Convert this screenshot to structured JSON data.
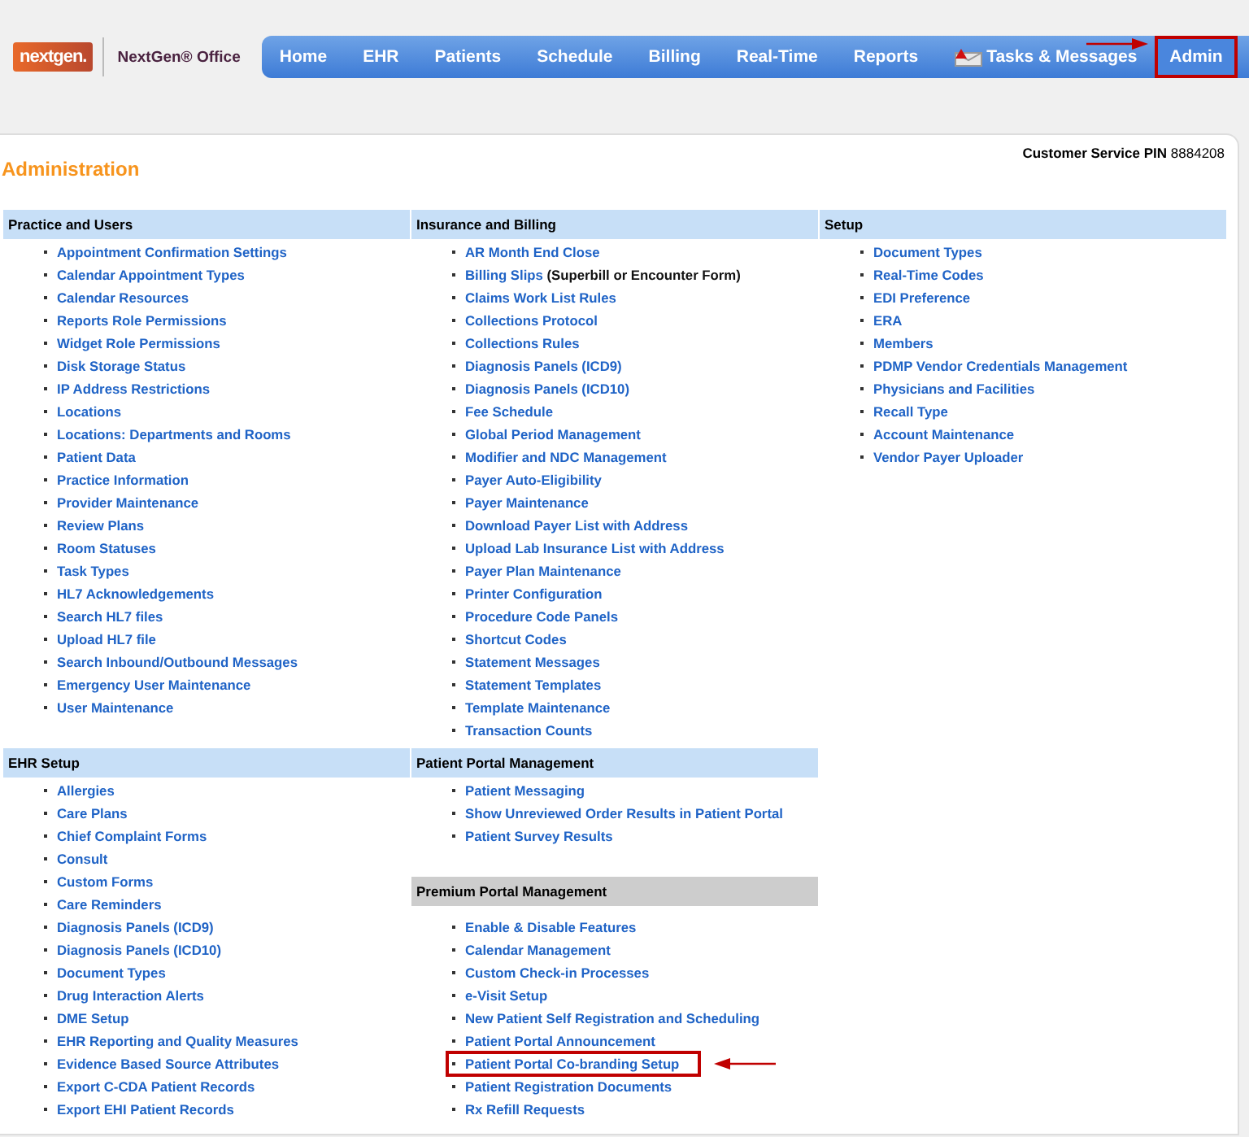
{
  "header": {
    "logo": "nextgen.",
    "product": "NextGen® Office",
    "nav": [
      {
        "label": "Home",
        "kind": "plain",
        "selected": false,
        "highlighted": false
      },
      {
        "label": "EHR",
        "kind": "plain",
        "selected": false,
        "highlighted": false
      },
      {
        "label": "Patients",
        "kind": "plain",
        "selected": false,
        "highlighted": false
      },
      {
        "label": "Schedule",
        "kind": "plain",
        "selected": false,
        "highlighted": false
      },
      {
        "label": "Billing",
        "kind": "plain",
        "selected": false,
        "highlighted": false
      },
      {
        "label": "Real-Time",
        "kind": "plain",
        "selected": false,
        "highlighted": false
      },
      {
        "label": "Reports",
        "kind": "plain",
        "selected": false,
        "highlighted": false
      },
      {
        "label": "Tasks & Messages",
        "kind": "mail",
        "selected": false,
        "highlighted": false
      },
      {
        "label": "Admin",
        "kind": "plain",
        "selected": true,
        "highlighted": true
      }
    ]
  },
  "page": {
    "title": "Administration",
    "pin_label": "Customer Service PIN",
    "pin": "8884208"
  },
  "rows": [
    {
      "columns": [
        {
          "sections": [
            {
              "title": "Practice and Users",
              "kind": "standard",
              "items": [
                {
                  "label": "Appointment Confirmation Settings",
                  "highlighted": false
                },
                {
                  "label": "Calendar Appointment Types",
                  "highlighted": false
                },
                {
                  "label": "Calendar Resources",
                  "highlighted": false
                },
                {
                  "label": "Reports Role Permissions",
                  "highlighted": false
                },
                {
                  "label": "Widget Role Permissions",
                  "highlighted": false
                },
                {
                  "label": "Disk Storage Status",
                  "highlighted": false
                },
                {
                  "label": "IP Address Restrictions",
                  "highlighted": false
                },
                {
                  "label": "Locations",
                  "highlighted": false
                },
                {
                  "label": "Locations: Departments and Rooms",
                  "highlighted": false
                },
                {
                  "label": "Patient Data",
                  "highlighted": false
                },
                {
                  "label": "Practice Information",
                  "highlighted": false
                },
                {
                  "label": "Provider Maintenance",
                  "highlighted": false
                },
                {
                  "label": "Review Plans",
                  "highlighted": false
                },
                {
                  "label": "Room Statuses",
                  "highlighted": false
                },
                {
                  "label": "Task Types",
                  "highlighted": false
                },
                {
                  "label": "HL7 Acknowledgements",
                  "highlighted": false
                },
                {
                  "label": "Search HL7 files",
                  "highlighted": false
                },
                {
                  "label": "Upload HL7 file",
                  "highlighted": false
                },
                {
                  "label": "Search Inbound/Outbound Messages",
                  "highlighted": false
                },
                {
                  "label": "Emergency User Maintenance",
                  "highlighted": false
                },
                {
                  "label": "User Maintenance",
                  "highlighted": false
                }
              ]
            }
          ]
        },
        {
          "sections": [
            {
              "title": "Insurance and Billing",
              "kind": "standard",
              "items": [
                {
                  "label": "AR Month End Close",
                  "highlighted": false
                },
                {
                  "label": "Billing Slips",
                  "note": "(Superbill or Encounter Form)",
                  "highlighted": false
                },
                {
                  "label": "Claims Work List Rules",
                  "highlighted": false
                },
                {
                  "label": "Collections Protocol",
                  "highlighted": false
                },
                {
                  "label": "Collections Rules",
                  "highlighted": false
                },
                {
                  "label": "Diagnosis Panels (ICD9)",
                  "highlighted": false
                },
                {
                  "label": "Diagnosis Panels (ICD10)",
                  "highlighted": false
                },
                {
                  "label": "Fee Schedule",
                  "highlighted": false
                },
                {
                  "label": "Global Period Management",
                  "highlighted": false
                },
                {
                  "label": "Modifier and NDC Management",
                  "highlighted": false
                },
                {
                  "label": "Payer Auto-Eligibility",
                  "highlighted": false
                },
                {
                  "label": "Payer Maintenance",
                  "highlighted": false
                },
                {
                  "label": "Download Payer List with Address",
                  "highlighted": false
                },
                {
                  "label": "Upload Lab Insurance List with Address",
                  "highlighted": false
                },
                {
                  "label": "Payer Plan Maintenance",
                  "highlighted": false
                },
                {
                  "label": "Printer Configuration",
                  "highlighted": false
                },
                {
                  "label": "Procedure Code Panels",
                  "highlighted": false
                },
                {
                  "label": "Shortcut Codes",
                  "highlighted": false
                },
                {
                  "label": "Statement Messages",
                  "highlighted": false
                },
                {
                  "label": "Statement Templates",
                  "highlighted": false
                },
                {
                  "label": "Template Maintenance",
                  "highlighted": false
                },
                {
                  "label": "Transaction Counts",
                  "highlighted": false
                }
              ]
            }
          ]
        },
        {
          "sections": [
            {
              "title": "Setup",
              "kind": "standard",
              "items": [
                {
                  "label": "Document Types",
                  "highlighted": false
                },
                {
                  "label": "Real-Time Codes",
                  "highlighted": false
                },
                {
                  "label": "EDI Preference",
                  "highlighted": false
                },
                {
                  "label": "ERA",
                  "highlighted": false
                },
                {
                  "label": "Members",
                  "highlighted": false
                },
                {
                  "label": "PDMP Vendor Credentials Management",
                  "highlighted": false
                },
                {
                  "label": "Physicians and Facilities",
                  "highlighted": false
                },
                {
                  "label": "Recall Type",
                  "highlighted": false
                },
                {
                  "label": "Account Maintenance",
                  "highlighted": false
                },
                {
                  "label": "Vendor Payer Uploader",
                  "highlighted": false
                }
              ]
            }
          ]
        }
      ]
    },
    {
      "columns": [
        {
          "sections": [
            {
              "title": "EHR Setup",
              "kind": "standard",
              "items": [
                {
                  "label": "Allergies",
                  "highlighted": false
                },
                {
                  "label": "Care Plans",
                  "highlighted": false
                },
                {
                  "label": "Chief Complaint Forms",
                  "highlighted": false
                },
                {
                  "label": "Consult",
                  "highlighted": false
                },
                {
                  "label": "Custom Forms",
                  "highlighted": false
                },
                {
                  "label": "Care Reminders",
                  "highlighted": false
                },
                {
                  "label": "Diagnosis Panels (ICD9)",
                  "highlighted": false
                },
                {
                  "label": "Diagnosis Panels (ICD10)",
                  "highlighted": false
                },
                {
                  "label": "Document Types",
                  "highlighted": false
                },
                {
                  "label": "Drug Interaction Alerts",
                  "highlighted": false
                },
                {
                  "label": "DME Setup",
                  "highlighted": false
                },
                {
                  "label": "EHR Reporting and Quality Measures",
                  "highlighted": false
                },
                {
                  "label": "Evidence Based Source Attributes",
                  "highlighted": false
                },
                {
                  "label": "Export C-CDA Patient Records",
                  "highlighted": false
                },
                {
                  "label": "Export EHI Patient Records",
                  "highlighted": false
                }
              ]
            }
          ]
        },
        {
          "sections": [
            {
              "title": "Patient Portal Management",
              "kind": "standard",
              "items": [
                {
                  "label": "Patient Messaging",
                  "highlighted": false
                },
                {
                  "label": "Show Unreviewed Order Results in Patient Portal",
                  "highlighted": false
                },
                {
                  "label": "Patient Survey Results",
                  "highlighted": false
                }
              ]
            },
            {
              "title": "Premium Portal Management",
              "kind": "premium",
              "items": [
                {
                  "label": "Enable & Disable Features",
                  "highlighted": false
                },
                {
                  "label": "Calendar Management",
                  "highlighted": false
                },
                {
                  "label": "Custom Check-in Processes",
                  "highlighted": false
                },
                {
                  "label": "e-Visit Setup",
                  "highlighted": false
                },
                {
                  "label": "New Patient Self Registration and Scheduling",
                  "highlighted": false
                },
                {
                  "label": "Patient Portal Announcement",
                  "highlighted": false
                },
                {
                  "label": "Patient Portal Co-branding Setup",
                  "highlighted": true
                },
                {
                  "label": "Patient Registration Documents",
                  "highlighted": false
                },
                {
                  "label": "Rx Refill Requests",
                  "highlighted": false
                }
              ]
            }
          ]
        }
      ]
    }
  ]
}
